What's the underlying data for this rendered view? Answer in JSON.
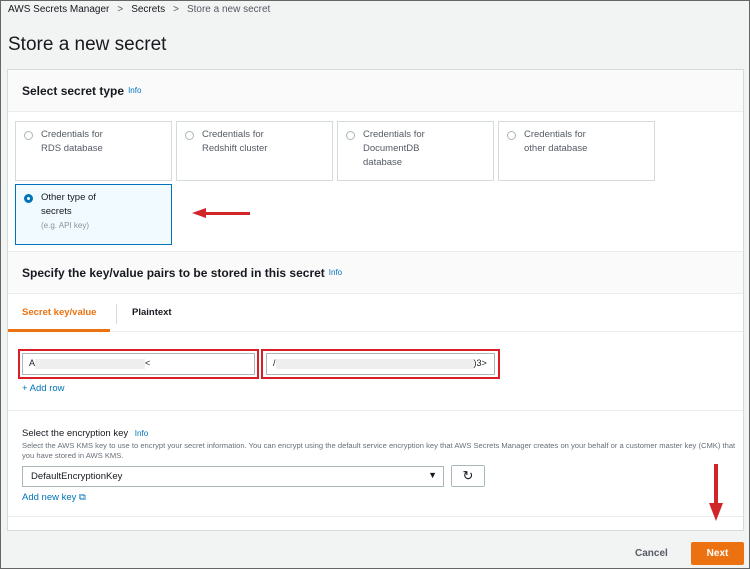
{
  "breadcrumb": [
    "AWS Secrets Manager",
    "Secrets",
    "Store a new secret"
  ],
  "title": "Store a new secret",
  "secret_type": {
    "heading": "Select secret type",
    "info": "Info",
    "options": [
      {
        "l1": "Credentials for",
        "l2": "RDS database"
      },
      {
        "l1": "Credentials for",
        "l2": "Redshift cluster"
      },
      {
        "l1": "Credentials for",
        "l2": "DocumentDB",
        "l3": "database"
      },
      {
        "l1": "Credentials for",
        "l2": "other database"
      },
      {
        "l1": "Other type of",
        "l2": "secrets",
        "l3": "(e.g. API key)",
        "selected": true
      }
    ]
  },
  "kv": {
    "heading": "Specify the key/value pairs to be stored in this secret",
    "info": "Info",
    "tabs": [
      "Secret key/value",
      "Plaintext"
    ],
    "key_start": "A",
    "key_end": "<",
    "value_start": "/",
    "value_end": ")3>",
    "add_row": "+ Add row"
  },
  "enc": {
    "label": "Select the encryption key",
    "info": "Info",
    "desc": "Select the AWS KMS key to use to encrypt your secret information. You can encrypt using the default service encryption key that AWS Secrets Manager creates on your behalf or a customer master key (CMK) that you have stored in AWS KMS.",
    "selected": "DefaultEncryptionKey",
    "add_key": "Add new key"
  },
  "footer": {
    "cancel": "Cancel",
    "next": "Next"
  }
}
